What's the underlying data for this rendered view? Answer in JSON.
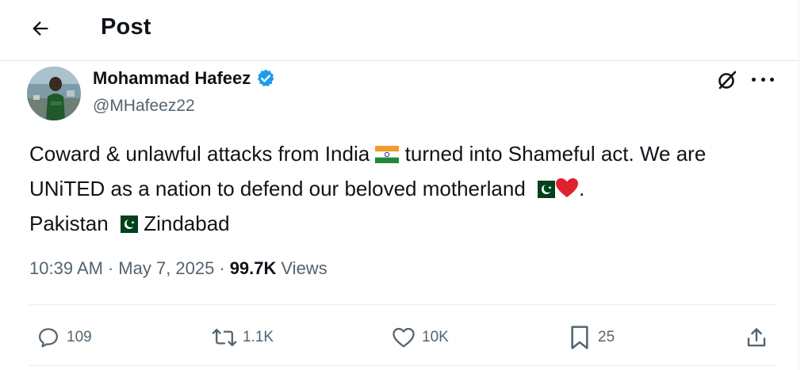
{
  "header": {
    "title": "Post",
    "back_icon": "arrow-left-icon"
  },
  "author": {
    "name": "Mohammad Hafeez",
    "handle": "@MHafeez22",
    "verified": true,
    "verified_color": "#1d9bf0"
  },
  "post": {
    "text_part1": "Coward & unlawful attacks from India",
    "text_part2": "turned into Shameful act. We are UNiTED as a nation to defend our beloved motherland",
    "text_part3": ".",
    "text_part4": "Pakistan",
    "text_part5": "Zindabad",
    "emojis": [
      "india-flag",
      "pakistan-flag",
      "red-heart",
      "pakistan-flag"
    ]
  },
  "meta": {
    "time": "10:39 AM",
    "sep1": "·",
    "date": "May 7, 2025",
    "sep2": "·",
    "views_count": "99.7K",
    "views_label": "Views"
  },
  "actions": {
    "replies": "109",
    "reposts": "1.1K",
    "likes": "10K",
    "bookmarks": "25"
  },
  "colors": {
    "text": "#0f1419",
    "secondary": "#536471",
    "accent": "#1d9bf0",
    "heart": "#e0202c"
  }
}
